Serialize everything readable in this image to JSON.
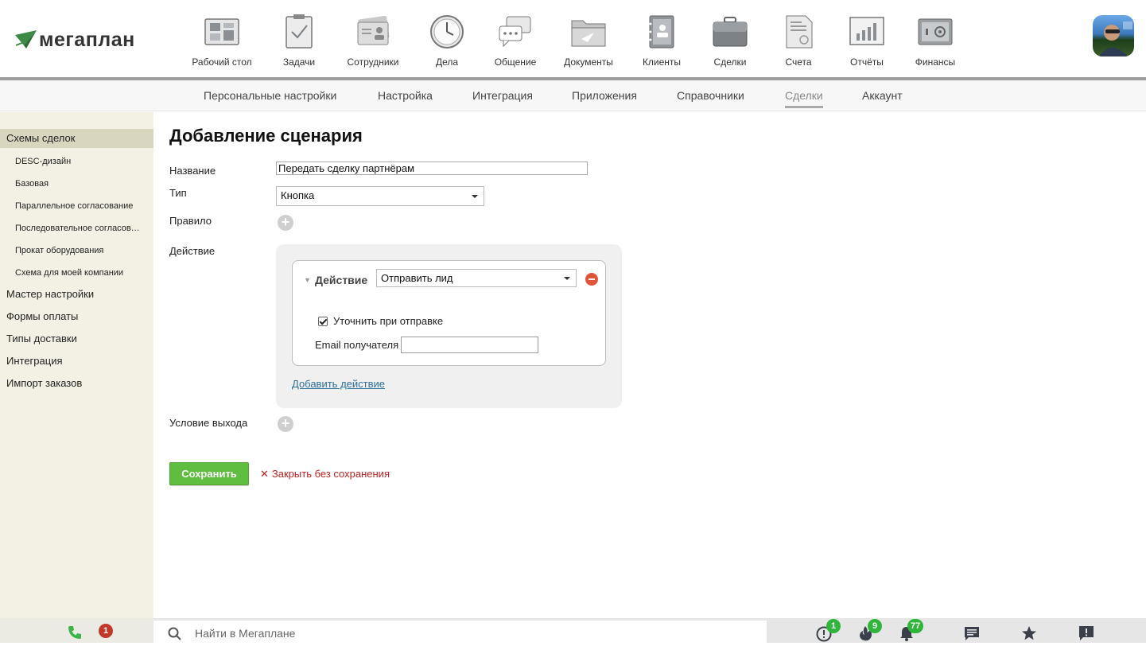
{
  "app": {
    "logo_text": "мегаплан"
  },
  "modules": [
    {
      "label": "Рабочий стол",
      "icon": "desktop-icon"
    },
    {
      "label": "Задачи",
      "icon": "tasks-icon"
    },
    {
      "label": "Сотрудники",
      "icon": "employees-icon"
    },
    {
      "label": "Дела",
      "icon": "clock-icon"
    },
    {
      "label": "Общение",
      "icon": "chat-icon"
    },
    {
      "label": "Документы",
      "icon": "folder-icon"
    },
    {
      "label": "Клиенты",
      "icon": "contacts-icon"
    },
    {
      "label": "Сделки",
      "icon": "briefcase-icon"
    },
    {
      "label": "Счета",
      "icon": "invoice-icon"
    },
    {
      "label": "Отчёты",
      "icon": "report-icon"
    },
    {
      "label": "Финансы",
      "icon": "safe-icon"
    }
  ],
  "subnav": [
    {
      "label": "Персональные настройки",
      "active": false
    },
    {
      "label": "Настройка",
      "active": false
    },
    {
      "label": "Интеграция",
      "active": false
    },
    {
      "label": "Приложения",
      "active": false
    },
    {
      "label": "Справочники",
      "active": false
    },
    {
      "label": "Сделки",
      "active": true
    },
    {
      "label": "Аккаунт",
      "active": false
    }
  ],
  "sidebar": {
    "items": [
      {
        "label": "Схемы сделок",
        "level": "top",
        "active": true
      },
      {
        "label": "DESC-дизайн",
        "level": "sub"
      },
      {
        "label": "Базовая",
        "level": "sub"
      },
      {
        "label": "Параллельное согласование",
        "level": "sub"
      },
      {
        "label": "Последовательное согласование",
        "level": "sub"
      },
      {
        "label": "Прокат оборудования",
        "level": "sub"
      },
      {
        "label": "Схема для моей компании",
        "level": "sub"
      },
      {
        "label": "Мастер настройки",
        "level": "top"
      },
      {
        "label": "Формы оплаты",
        "level": "top"
      },
      {
        "label": "Типы доставки",
        "level": "top"
      },
      {
        "label": "Интеграция",
        "level": "top"
      },
      {
        "label": "Импорт заказов",
        "level": "top"
      }
    ]
  },
  "form": {
    "title": "Добавление сценария",
    "name_label": "Название",
    "name_value": "Передать сделку партнёрам",
    "type_label": "Тип",
    "type_value": "Кнопка",
    "rule_label": "Правило",
    "action_label": "Действие",
    "action": {
      "title": "Действие",
      "select_value": "Отправить лид",
      "checkbox_label": "Уточнить при отправке",
      "checkbox_checked": true,
      "email_label": "Email получателя",
      "email_value": ""
    },
    "add_action_link": "Добавить действие",
    "exit_condition_label": "Условие выхода",
    "save_label": "Сохранить",
    "close_label": "Закрыть без сохранения"
  },
  "bottombar": {
    "missed_calls": "1",
    "search_placeholder": "Найти в Мегаплане",
    "notifications": [
      {
        "icon": "alert-circle-icon",
        "count": "1"
      },
      {
        "icon": "fire-icon",
        "count": "9"
      },
      {
        "icon": "bell-icon",
        "count": "77"
      },
      {
        "icon": "message-icon",
        "count": ""
      },
      {
        "icon": "star-icon",
        "count": ""
      },
      {
        "icon": "feedback-icon",
        "count": ""
      }
    ]
  },
  "colors": {
    "accent_green": "#5fbd3f",
    "sidebar_bg": "#f3f1e4",
    "danger": "#c0211f",
    "link": "#2a6e9a"
  }
}
